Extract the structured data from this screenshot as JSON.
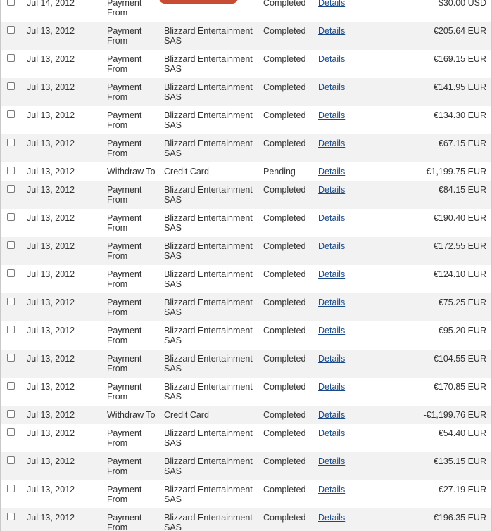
{
  "transactions": [
    {
      "date": "Jul 14, 2012",
      "type": "Payment From",
      "name": "",
      "redacted": true,
      "status": "Completed",
      "details": "Details",
      "amount": "$30.00 USD"
    },
    {
      "date": "Jul 13, 2012",
      "type": "Payment From",
      "name": "Blizzard Entertainment SAS",
      "status": "Completed",
      "details": "Details",
      "amount": "€205.64 EUR"
    },
    {
      "date": "Jul 13, 2012",
      "type": "Payment From",
      "name": "Blizzard Entertainment SAS",
      "status": "Completed",
      "details": "Details",
      "amount": "€169.15 EUR"
    },
    {
      "date": "Jul 13, 2012",
      "type": "Payment From",
      "name": "Blizzard Entertainment SAS",
      "status": "Completed",
      "details": "Details",
      "amount": "€141.95 EUR"
    },
    {
      "date": "Jul 13, 2012",
      "type": "Payment From",
      "name": "Blizzard Entertainment SAS",
      "status": "Completed",
      "details": "Details",
      "amount": "€134.30 EUR"
    },
    {
      "date": "Jul 13, 2012",
      "type": "Payment From",
      "name": "Blizzard Entertainment SAS",
      "status": "Completed",
      "details": "Details",
      "amount": "€67.15 EUR"
    },
    {
      "date": "Jul 13, 2012",
      "type": "Withdraw To",
      "name": "Credit Card",
      "status": "Pending",
      "details": "Details",
      "amount": "-€1,199.75 EUR"
    },
    {
      "date": "Jul 13, 2012",
      "type": "Payment From",
      "name": "Blizzard Entertainment SAS",
      "status": "Completed",
      "details": "Details",
      "amount": "€84.15 EUR"
    },
    {
      "date": "Jul 13, 2012",
      "type": "Payment From",
      "name": "Blizzard Entertainment SAS",
      "status": "Completed",
      "details": "Details",
      "amount": "€190.40 EUR"
    },
    {
      "date": "Jul 13, 2012",
      "type": "Payment From",
      "name": "Blizzard Entertainment SAS",
      "status": "Completed",
      "details": "Details",
      "amount": "€172.55 EUR"
    },
    {
      "date": "Jul 13, 2012",
      "type": "Payment From",
      "name": "Blizzard Entertainment SAS",
      "status": "Completed",
      "details": "Details",
      "amount": "€124.10 EUR"
    },
    {
      "date": "Jul 13, 2012",
      "type": "Payment From",
      "name": "Blizzard Entertainment SAS",
      "status": "Completed",
      "details": "Details",
      "amount": "€75.25 EUR"
    },
    {
      "date": "Jul 13, 2012",
      "type": "Payment From",
      "name": "Blizzard Entertainment SAS",
      "status": "Completed",
      "details": "Details",
      "amount": "€95.20 EUR"
    },
    {
      "date": "Jul 13, 2012",
      "type": "Payment From",
      "name": "Blizzard Entertainment SAS",
      "status": "Completed",
      "details": "Details",
      "amount": "€104.55 EUR"
    },
    {
      "date": "Jul 13, 2012",
      "type": "Payment From",
      "name": "Blizzard Entertainment SAS",
      "status": "Completed",
      "details": "Details",
      "amount": "€170.85 EUR"
    },
    {
      "date": "Jul 13, 2012",
      "type": "Withdraw To",
      "name": "Credit Card",
      "status": "Completed",
      "details": "Details",
      "amount": "-€1,199.76 EUR"
    },
    {
      "date": "Jul 13, 2012",
      "type": "Payment From",
      "name": "Blizzard Entertainment SAS",
      "status": "Completed",
      "details": "Details",
      "amount": "€54.40 EUR"
    },
    {
      "date": "Jul 13, 2012",
      "type": "Payment From",
      "name": "Blizzard Entertainment SAS",
      "status": "Completed",
      "details": "Details",
      "amount": "€135.15 EUR"
    },
    {
      "date": "Jul 13, 2012",
      "type": "Payment From",
      "name": "Blizzard Entertainment SAS",
      "status": "Completed",
      "details": "Details",
      "amount": "€27.19 EUR"
    },
    {
      "date": "Jul 13, 2012",
      "type": "Payment From",
      "name": "Blizzard Entertainment SAS",
      "status": "Completed",
      "details": "Details",
      "amount": "€196.35 EUR"
    }
  ],
  "colors": {
    "row_alt_bg": "#f2f2f2",
    "link": "#1a4a8a",
    "redaction": "#c84b33"
  }
}
